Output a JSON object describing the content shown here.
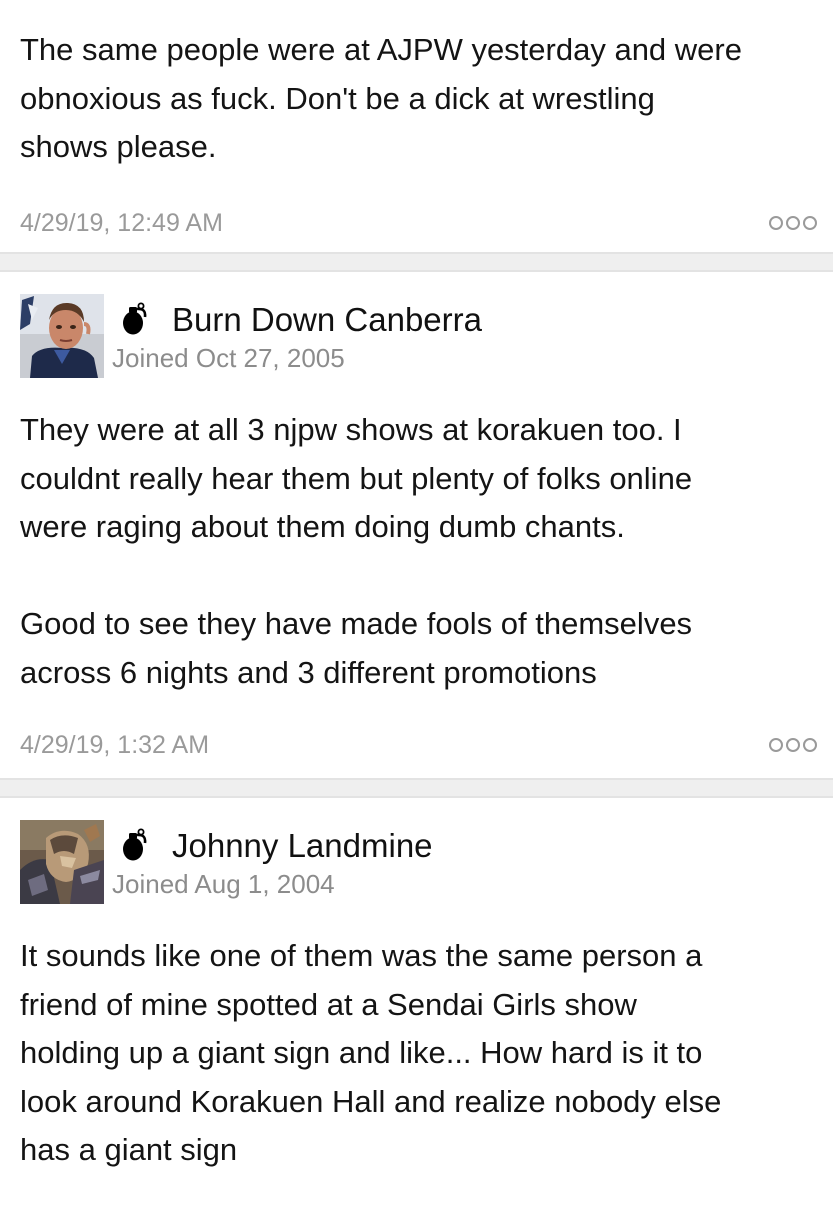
{
  "posts": [
    {
      "body": [
        "The same people were at AJPW yesterday and were",
        "obnoxious as fuck. Don't be a dick at wrestling",
        "shows please."
      ],
      "timestamp": "4/29/19, 12:49 AM"
    },
    {
      "author": "Burn Down Canberra",
      "joined": "Joined Oct 27, 2005",
      "avatar_icon": "man-portrait-avatar",
      "badge_icon": "grenade-icon",
      "body": [
        "They were at all 3 njpw shows at korakuen too. I",
        "couldnt really hear them but plenty of folks online",
        "were raging about them doing dumb chants.",
        "",
        "Good to see they have made fools of themselves",
        "across 6 nights and 3 different promotions"
      ],
      "timestamp": "4/29/19, 1:32 AM"
    },
    {
      "author": "Johnny Landmine",
      "joined": "Joined Aug 1, 2004",
      "avatar_icon": "armored-figure-avatar",
      "badge_icon": "grenade-icon",
      "body": [
        "It sounds like one of them was the same person a",
        "friend of mine spotted at a Sendai Girls show",
        "holding up a giant sign and like... How hard is it to",
        "look around Korakuen Hall and realize nobody else",
        "has a giant sign"
      ]
    }
  ],
  "colors": {
    "text": "#141414",
    "meta": "#9a9a9a",
    "separator": "#efefef"
  }
}
